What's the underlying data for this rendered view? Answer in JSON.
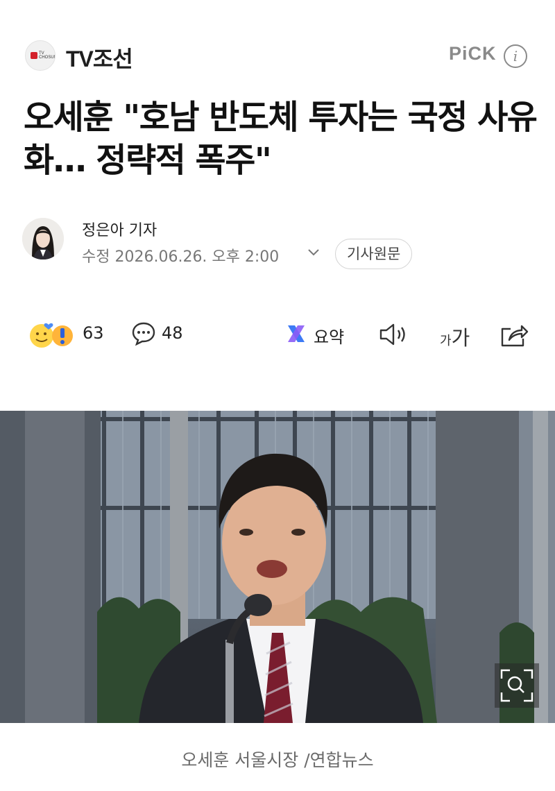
{
  "press": {
    "name": "TV조선",
    "logo_text": "TV CHOSUN",
    "pick_label": "PiCK",
    "info_symbol": "i"
  },
  "article": {
    "headline": "오세훈 \"호남 반도체 투자는 국정 사유화… 정략적 폭주\"",
    "reporter": "정은아 기자",
    "meta": "수정 2026.06.26. 오후 2:00",
    "original_button": "기사원문",
    "photo_caption": "오세훈 서울시장 /연합뉴스"
  },
  "actions": {
    "reactions_count": "63",
    "comments_count": "48",
    "summary_label": "요약",
    "font_small": "가",
    "font_big": "가"
  },
  "colors": {
    "brand_red": "#d3202a",
    "summary_blue": "#3d7af5",
    "summary_purple": "#8b5cf6",
    "muted_gray": "#8a8a8a"
  },
  "icons": [
    "info-icon",
    "chevron-down-icon",
    "reaction-emoji-icon",
    "comment-icon",
    "summary-icon",
    "speaker-icon",
    "font-size-icon",
    "share-icon",
    "zoom-icon"
  ]
}
